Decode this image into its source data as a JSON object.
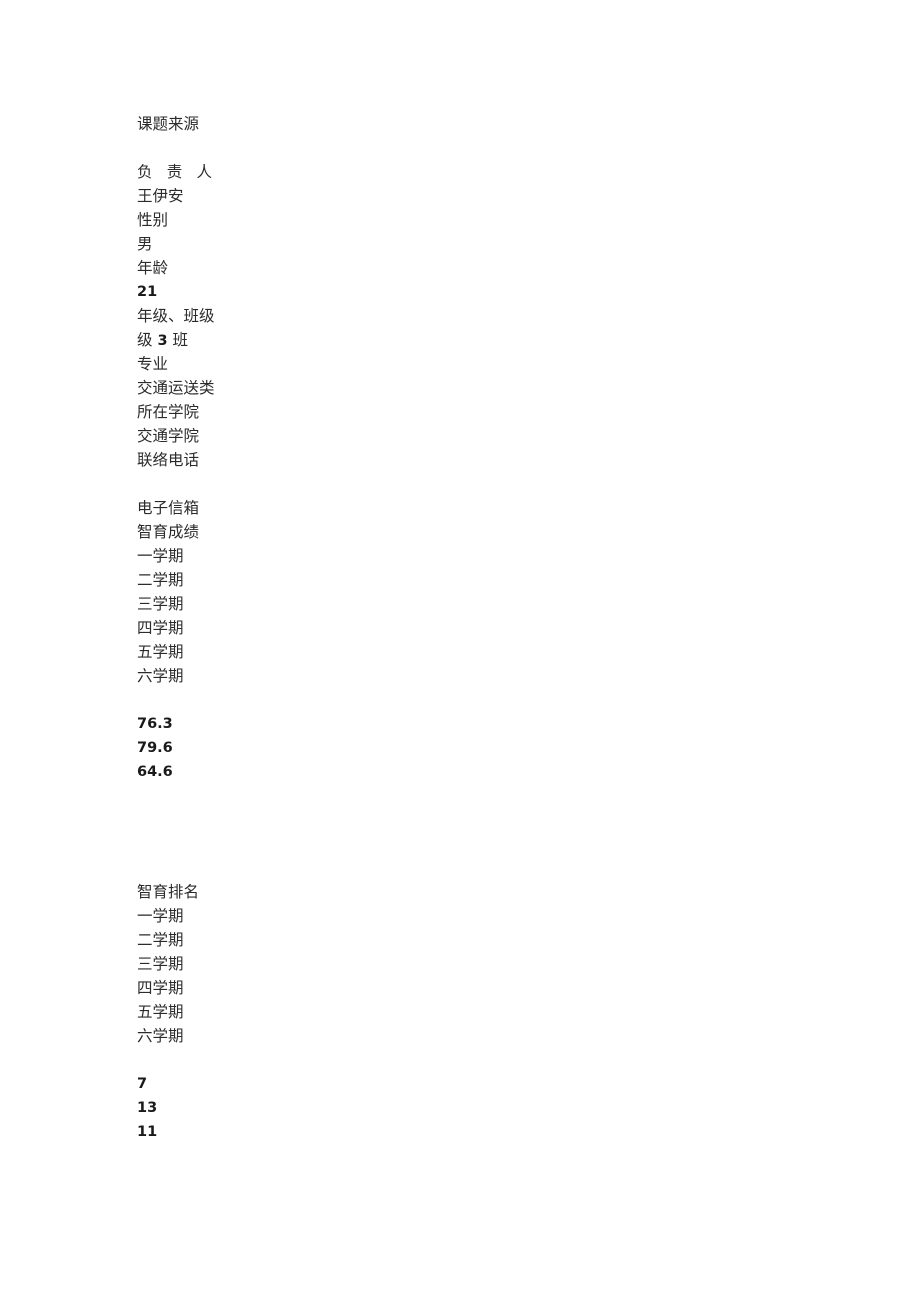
{
  "document": {
    "heading": "课题来源",
    "person": {
      "leader_label": "负 责 人",
      "leader_name": "王伊安",
      "gender_label": "性别",
      "gender_value": "男",
      "age_label": "年龄",
      "age_value": "21",
      "grade_class_label": "年级、班级",
      "grade_class_value_prefix": "级",
      "grade_class_value_digit": "3",
      "grade_class_value_suffix": "班",
      "major_label": "专业",
      "major_value": "交通运送类",
      "college_label": "所在学院",
      "college_value": "交通学院",
      "phone_label": "联络电话",
      "phone_value": "",
      "email_label": "电子信箱",
      "email_value": ""
    },
    "scores_section": {
      "title": "智育成绩",
      "semester_labels": [
        "一学期",
        "二学期",
        "三学期",
        "四学期",
        "五学期",
        "六学期"
      ],
      "values": [
        "76.3",
        "79.6",
        "64.6",
        "",
        "",
        ""
      ]
    },
    "rank_section": {
      "title": "智育排名",
      "semester_labels": [
        "一学期",
        "二学期",
        "三学期",
        "四学期",
        "五学期",
        "六学期"
      ],
      "values": [
        "7",
        "13",
        "11",
        "",
        "",
        ""
      ]
    }
  }
}
